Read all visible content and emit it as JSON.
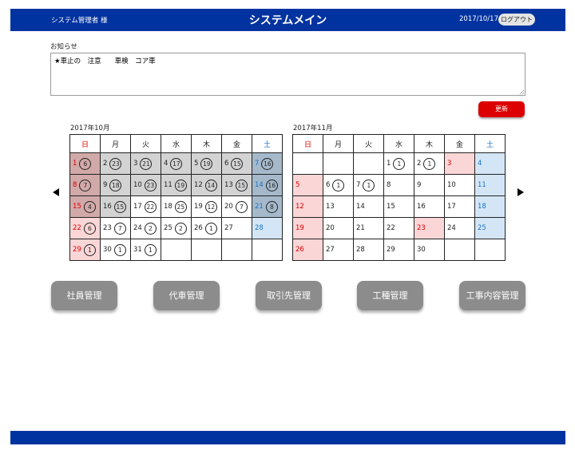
{
  "header": {
    "user": "システム管理者 様",
    "title": "システムメイン",
    "date": "2017/10/17",
    "logout_label": "ログアウト"
  },
  "notice": {
    "label": "お知らせ",
    "text": "★車止の　注意　　車検　コア車"
  },
  "update_label": "更新",
  "weekdays": [
    "日",
    "月",
    "火",
    "水",
    "木",
    "金",
    "土"
  ],
  "calendars": [
    {
      "title": "2017年10月",
      "weeks": [
        [
          {
            "d": "1",
            "c": "6"
          },
          {
            "d": "2",
            "c": "23"
          },
          {
            "d": "3",
            "c": "21"
          },
          {
            "d": "4",
            "c": "17"
          },
          {
            "d": "5",
            "c": "19"
          },
          {
            "d": "6",
            "c": "15"
          },
          {
            "d": "7",
            "c": "16"
          }
        ],
        [
          {
            "d": "8",
            "c": "7"
          },
          {
            "d": "9",
            "c": "18"
          },
          {
            "d": "10",
            "c": "23"
          },
          {
            "d": "11",
            "c": "19"
          },
          {
            "d": "12",
            "c": "14"
          },
          {
            "d": "13",
            "c": "15"
          },
          {
            "d": "14",
            "c": "16"
          }
        ],
        [
          {
            "d": "15",
            "c": "4"
          },
          {
            "d": "16",
            "c": "15"
          },
          {
            "d": "17",
            "c": "22"
          },
          {
            "d": "18",
            "c": "25"
          },
          {
            "d": "19",
            "c": "12"
          },
          {
            "d": "20",
            "c": "7"
          },
          {
            "d": "21",
            "c": "8"
          }
        ],
        [
          {
            "d": "22",
            "c": "6"
          },
          {
            "d": "23",
            "c": "7"
          },
          {
            "d": "24",
            "c": "2"
          },
          {
            "d": "25",
            "c": "2"
          },
          {
            "d": "26",
            "c": "1"
          },
          {
            "d": "27",
            "c": ""
          },
          {
            "d": "28",
            "c": ""
          }
        ],
        [
          {
            "d": "29",
            "c": "1"
          },
          {
            "d": "30",
            "c": "1"
          },
          {
            "d": "31",
            "c": "1"
          },
          {
            "d": "",
            "c": ""
          },
          {
            "d": "",
            "c": ""
          },
          {
            "d": "",
            "c": ""
          },
          {
            "d": "",
            "c": ""
          }
        ]
      ]
    },
    {
      "title": "2017年11月",
      "weeks": [
        [
          {
            "d": "",
            "c": ""
          },
          {
            "d": "",
            "c": ""
          },
          {
            "d": "",
            "c": ""
          },
          {
            "d": "1",
            "c": "1"
          },
          {
            "d": "2",
            "c": "1"
          },
          {
            "d": "3",
            "c": ""
          },
          {
            "d": "4",
            "c": ""
          }
        ],
        [
          {
            "d": "5",
            "c": ""
          },
          {
            "d": "6",
            "c": "1"
          },
          {
            "d": "7",
            "c": "1"
          },
          {
            "d": "8",
            "c": ""
          },
          {
            "d": "9",
            "c": ""
          },
          {
            "d": "10",
            "c": ""
          },
          {
            "d": "11",
            "c": ""
          }
        ],
        [
          {
            "d": "12",
            "c": ""
          },
          {
            "d": "13",
            "c": ""
          },
          {
            "d": "14",
            "c": ""
          },
          {
            "d": "15",
            "c": ""
          },
          {
            "d": "16",
            "c": ""
          },
          {
            "d": "17",
            "c": ""
          },
          {
            "d": "18",
            "c": ""
          }
        ],
        [
          {
            "d": "19",
            "c": ""
          },
          {
            "d": "20",
            "c": ""
          },
          {
            "d": "21",
            "c": ""
          },
          {
            "d": "22",
            "c": ""
          },
          {
            "d": "23",
            "c": ""
          },
          {
            "d": "24",
            "c": ""
          },
          {
            "d": "25",
            "c": ""
          }
        ],
        [
          {
            "d": "26",
            "c": ""
          },
          {
            "d": "27",
            "c": ""
          },
          {
            "d": "28",
            "c": ""
          },
          {
            "d": "29",
            "c": ""
          },
          {
            "d": "30",
            "c": ""
          },
          {
            "d": "",
            "c": ""
          },
          {
            "d": "",
            "c": ""
          }
        ]
      ]
    }
  ],
  "menu": [
    "社員管理",
    "代車管理",
    "取引先管理",
    "工種管理",
    "工事内容管理"
  ],
  "colors": {
    "header": "#0033a0",
    "update_button": "#dd0000",
    "menu_button": "#8c8c8c",
    "sunday": "#dd0000",
    "saturday": "#1a73c8"
  }
}
